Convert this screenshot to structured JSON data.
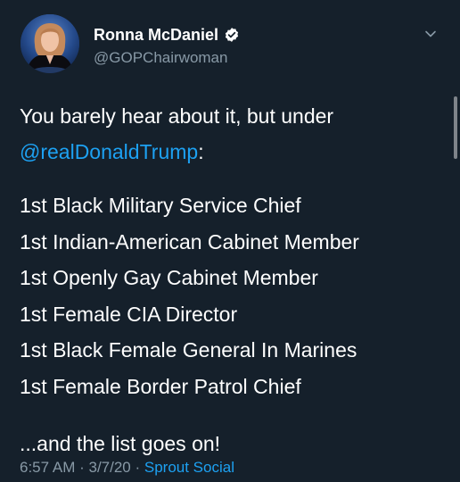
{
  "colors": {
    "background": "#15202b",
    "text": "#ffffff",
    "secondary_text": "#8899a6",
    "link": "#1da1f2"
  },
  "author": {
    "display_name": "Ronna McDaniel",
    "handle": "@GOPChairwoman",
    "verified": true,
    "verified_icon": "verified-badge-icon",
    "avatar_icon": "profile-photo"
  },
  "menu_icon": "chevron-down-icon",
  "tweet": {
    "intro": "You barely hear about it, but under",
    "mention": "@realDonaldTrump",
    "mention_suffix": ":",
    "list": [
      "1st Black Military Service Chief",
      "1st Indian-American Cabinet Member",
      "1st Openly Gay Cabinet Member",
      "1st Female CIA Director",
      "1st Black Female General In Marines",
      "1st Female Border Patrol Chief"
    ],
    "closing": "...and the list goes on!"
  },
  "meta": {
    "time": "6:57 AM",
    "separator1": " · ",
    "date": "3/7/20",
    "separator2": " · ",
    "source": "Sprout Social"
  }
}
